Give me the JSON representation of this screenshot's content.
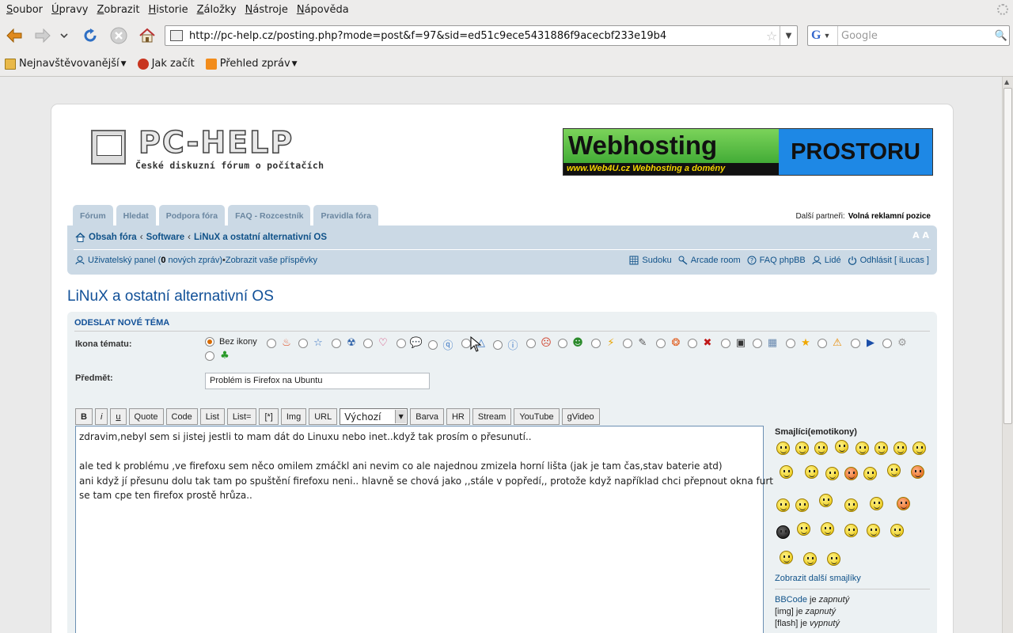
{
  "browser": {
    "menu": [
      {
        "u": "S",
        "rest": "oubor"
      },
      {
        "u": "Ú",
        "rest": "pravy"
      },
      {
        "u": "Z",
        "rest": "obrazit"
      },
      {
        "u": "H",
        "rest": "istorie"
      },
      {
        "u": "Z",
        "rest": "áložky"
      },
      {
        "u": "N",
        "rest": "ástroje"
      },
      {
        "u": "N",
        "rest": "ápověda"
      }
    ],
    "url": "http://pc-help.cz/posting.php?mode=post&f=97&sid=ed51c9ece5431886f9acecbf233e19b4",
    "search_placeholder": "Google",
    "search_engine_letter": "G",
    "bookmarks": [
      "Nejnavštěvovanější",
      "Jak začít",
      "Přehled zpráv"
    ]
  },
  "site": {
    "logo_name": "PC-HELP",
    "logo_sub": "České diskuzní fórum o počítačích",
    "banner_big": "Webhosting",
    "banner_small": "www.Web4U.cz  Webhosting a domény",
    "banner_right": "PROSTORU",
    "tabs": [
      "Fórum",
      "Hledat",
      "Podpora fóra",
      "FAQ - Rozcestník",
      "Pravidla fóra"
    ],
    "partners_label": "Další partneři:",
    "partners_value": "Volná reklamní pozice",
    "breadcrumbs": [
      "Obsah fóra",
      "Software",
      "LiNuX a ostatní alternativní OS"
    ],
    "fontsize_glyph": "A A",
    "userpanel": {
      "text_before": "Uživatelský panel (",
      "count": "0",
      "text_after": " nových zpráv)",
      "bullet": " • ",
      "link": "Zobrazit vaše příspěvky"
    },
    "right_links": [
      "Sudoku",
      "Arcade room",
      "FAQ phpBB",
      "Lidé",
      "Odhlásit [ iLucas ]"
    ],
    "page_title": "LiNuX a ostatní alternativní OS"
  },
  "form": {
    "heading": "ODESLAT NOVÉ TÉMA",
    "topic_icon_label": "Ikona tématu:",
    "no_icon_label": "Bez ikony",
    "subject_label": "Předmět:",
    "subject_value": "Problém is Firefox na Ubuntu",
    "toolbar_buttons": [
      "B",
      "i",
      "u",
      "Quote",
      "Code",
      "List",
      "List=",
      "[*]",
      "Img",
      "URL"
    ],
    "toolbar_select": "Výchozí",
    "toolbar_buttons2": [
      "Barva",
      "HR",
      "Stream",
      "YouTube",
      "gVideo"
    ],
    "message_lines": [
      "zdravim,nebyl sem si jistej jestli to mam dát do Linuxu nebo inet..když tak prosím o přesunutí..",
      "",
      "ale ted k problému ,ve firefoxu sem něco omilem zmáčkl ani nevim co ale najednou zmizela horní lišta (jak je tam čas,stav baterie atd)",
      "ani když jí přesunu dolu tak tam po spuštění firefoxu neni.. hlavně se chová jako ,,stále v popředí,, protože když například chci přepnout okna furt",
      "se tam cpe ten firefox prostě hrůza.."
    ],
    "smilies_title": "Smajlíci(emotikony)",
    "smilies_more": "Zobrazit další smajlíky",
    "status": [
      {
        "code": "BBCode",
        "je": " je ",
        "state": "zapnutý"
      },
      {
        "code": "[img]",
        "je": " je ",
        "state": "zapnutý"
      },
      {
        "code": "[flash]",
        "je": " je ",
        "state": "vypnutý"
      }
    ]
  },
  "colors": {
    "accent": "#105289",
    "panel": "#cbd9e5",
    "form_bg": "#ecf1f3"
  }
}
